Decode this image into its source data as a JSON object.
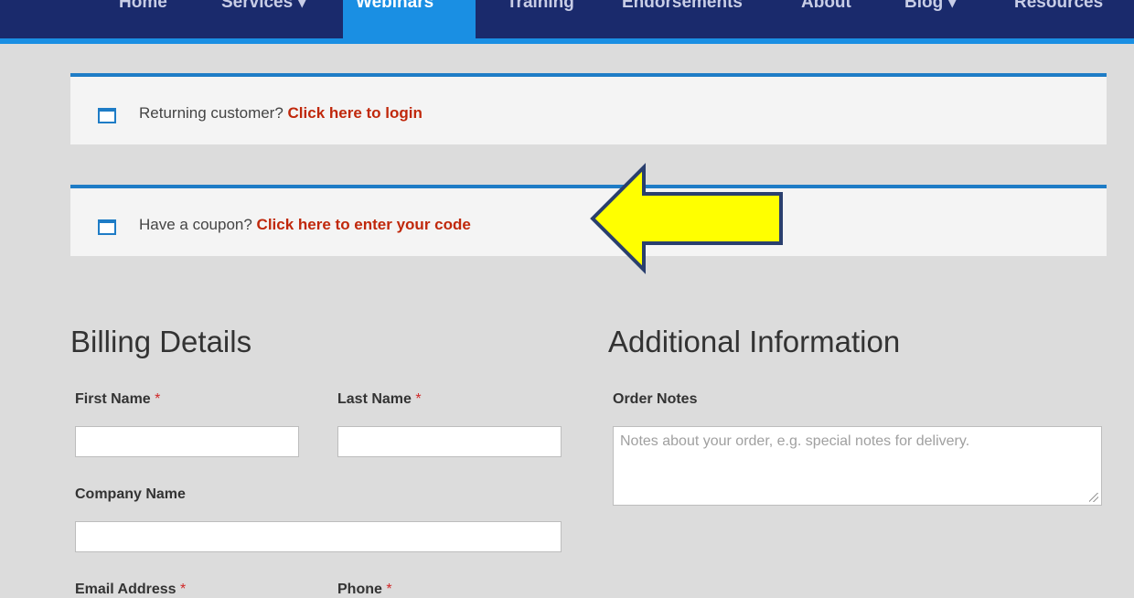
{
  "nav": {
    "items": [
      {
        "label": "Home"
      },
      {
        "label": "Services ▾"
      },
      {
        "label": "Webinars"
      },
      {
        "label": "Training"
      },
      {
        "label": "Endorsements"
      },
      {
        "label": "About"
      },
      {
        "label": "Blog ▾"
      },
      {
        "label": "Resources"
      }
    ],
    "active_index": 2
  },
  "notices": {
    "login": {
      "text": "Returning customer? ",
      "link": "Click here to login"
    },
    "coupon": {
      "text": "Have a coupon? ",
      "link": "Click here to enter your code"
    }
  },
  "billing": {
    "title": "Billing Details",
    "first_name_label": "First Name",
    "last_name_label": "Last Name",
    "company_label": "Company Name",
    "email_label": "Email Address",
    "phone_label": "Phone",
    "required_mark": "*"
  },
  "additional": {
    "title": "Additional Information",
    "order_notes_label": "Order Notes",
    "order_notes_placeholder": "Notes about your order, e.g. special notes for delivery."
  },
  "colors": {
    "nav_bg": "#1a2a6c",
    "nav_active": "#1a8fe3",
    "notice_border": "#1e7cc6",
    "link": "#c0280b",
    "arrow_fill": "#ffff00",
    "arrow_stroke": "#2a3f6e"
  }
}
